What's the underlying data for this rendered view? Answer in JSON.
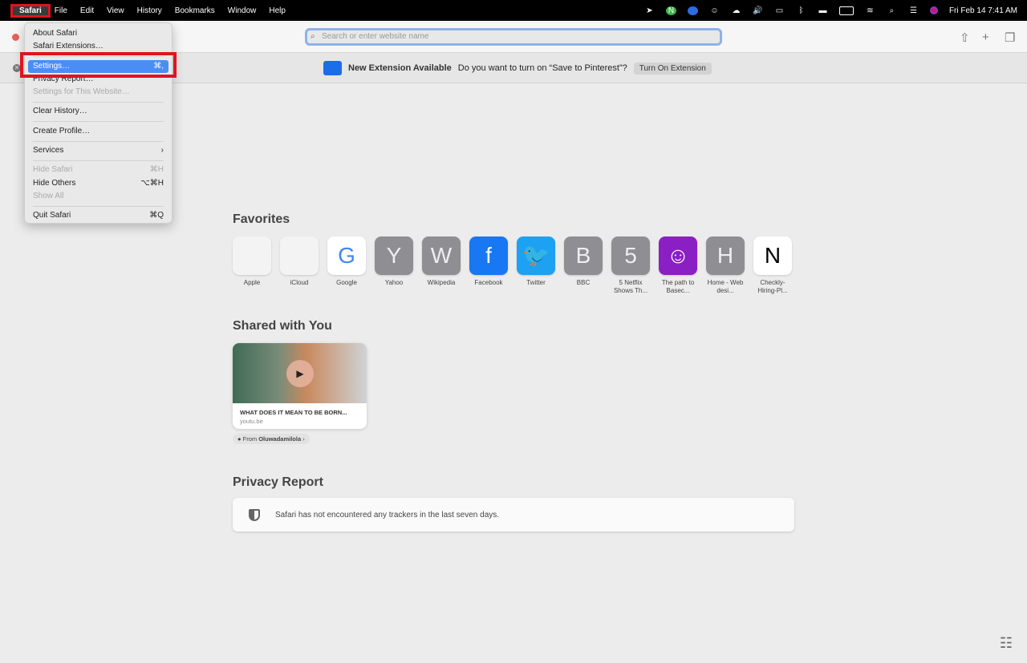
{
  "menubar": {
    "apple": "",
    "app": "Safari",
    "items": [
      "File",
      "Edit",
      "View",
      "History",
      "Bookmarks",
      "Window",
      "Help"
    ],
    "clock": "Fri Feb 14  7:41 AM"
  },
  "toolbar": {
    "url_placeholder": "Search or enter website name"
  },
  "extension_banner": {
    "title": "New Extension Available",
    "message": "Do you want to turn on “Save to Pinterest”?",
    "button": "Turn On Extension"
  },
  "safari_menu": {
    "items": [
      {
        "label": "About Safari",
        "shortcut": "",
        "disabled": false
      },
      {
        "label": "Safari Extensions…",
        "shortcut": "",
        "disabled": false
      },
      {
        "sep": true
      },
      {
        "label": "Settings…",
        "shortcut": "⌘,",
        "selected": true
      },
      {
        "label": "Privacy Report…",
        "shortcut": ""
      },
      {
        "label": "Settings for This Website…",
        "shortcut": "",
        "disabled": true
      },
      {
        "sep": true
      },
      {
        "label": "Clear History…",
        "shortcut": ""
      },
      {
        "sep": true
      },
      {
        "label": "Create Profile…",
        "shortcut": ""
      },
      {
        "sep": true
      },
      {
        "label": "Services",
        "shortcut": "›"
      },
      {
        "sep": true
      },
      {
        "label": "Hide Safari",
        "shortcut": "⌘H",
        "disabled": true
      },
      {
        "label": "Hide Others",
        "shortcut": "⌥⌘H"
      },
      {
        "label": "Show All",
        "shortcut": "",
        "disabled": true
      },
      {
        "sep": true
      },
      {
        "label": "Quit Safari",
        "shortcut": "⌘Q"
      }
    ]
  },
  "favorites": {
    "title": "Favorites",
    "items": [
      {
        "label": "Apple",
        "glyph": "",
        "bg": "#f3f3f3",
        "fg": "#666"
      },
      {
        "label": "iCloud",
        "glyph": "",
        "bg": "#f3f3f3",
        "fg": "#888"
      },
      {
        "label": "Google",
        "glyph": "G",
        "bg": "#ffffff",
        "fg": "#4285f4"
      },
      {
        "label": "Yahoo",
        "glyph": "Y",
        "bg": "#8e8e93",
        "fg": "#eee"
      },
      {
        "label": "Wikipedia",
        "glyph": "W",
        "bg": "#8e8e93",
        "fg": "#eee"
      },
      {
        "label": "Facebook",
        "glyph": "f",
        "bg": "#1877f2",
        "fg": "#fff"
      },
      {
        "label": "Twitter",
        "glyph": "🐦",
        "bg": "#1da1f2",
        "fg": "#fff"
      },
      {
        "label": "BBC",
        "glyph": "B",
        "bg": "#8e8e93",
        "fg": "#eee"
      },
      {
        "label": "5 Netflix Shows Th...",
        "glyph": "5",
        "bg": "#8e8e93",
        "fg": "#eee"
      },
      {
        "label": "The path to Basec...",
        "glyph": "☺",
        "bg": "#8a1fc4",
        "fg": "#fff"
      },
      {
        "label": "Home - Web desi...",
        "glyph": "H",
        "bg": "#8e8e93",
        "fg": "#eee"
      },
      {
        "label": "Checkly-Hiring-Pl...",
        "glyph": "N",
        "bg": "#ffffff",
        "fg": "#000"
      }
    ]
  },
  "shared": {
    "title": "Shared with You",
    "card_title": "WHAT DOES IT MEAN TO BE BORN...",
    "card_source": "youtu.be",
    "from_label": "From",
    "from_name": "Oluwadamilola"
  },
  "privacy": {
    "title": "Privacy Report",
    "message": "Safari has not encountered any trackers in the last seven days."
  }
}
